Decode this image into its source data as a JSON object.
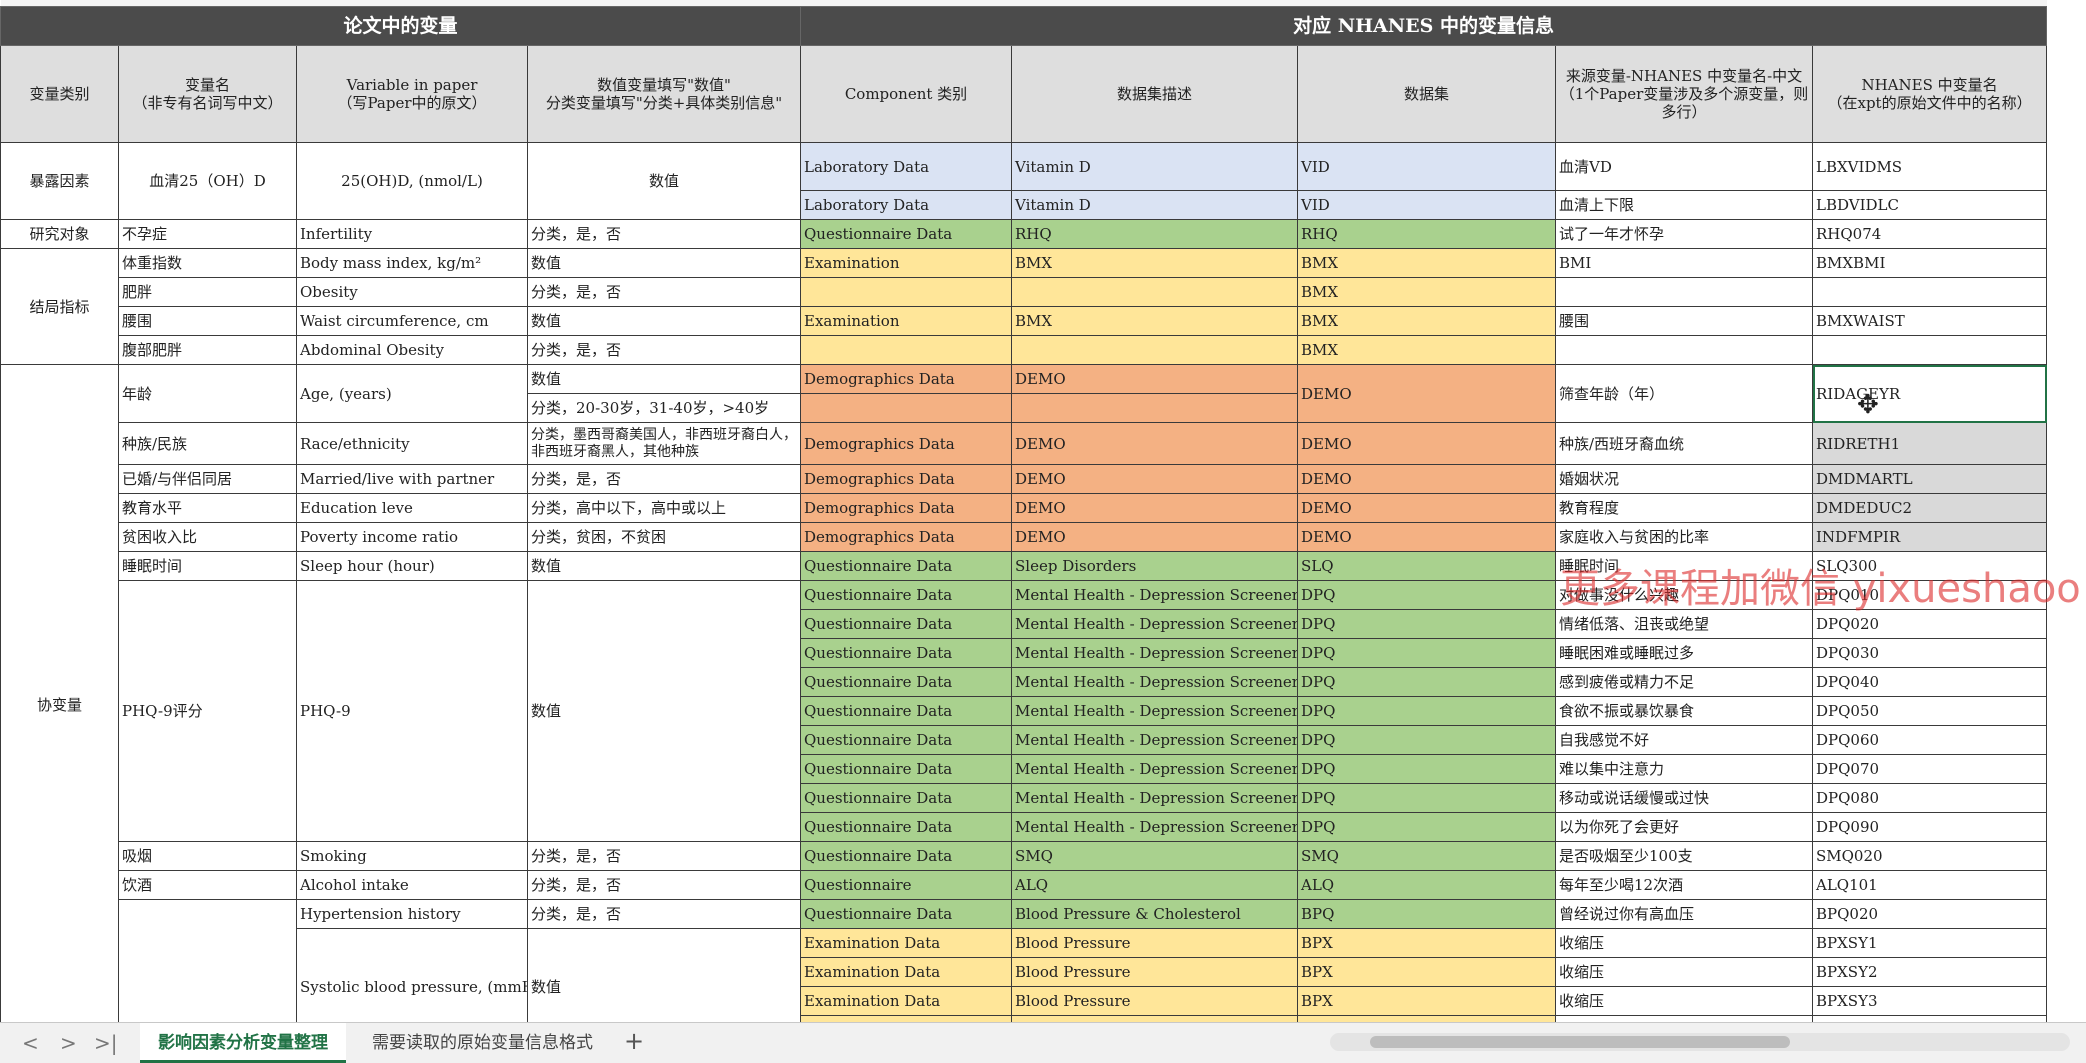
{
  "header": {
    "left": "论文中的变量",
    "right": "对应 NHANES 中的变量信息",
    "cols": [
      "变量类别",
      "变量名\n（非专有名词写中文）",
      "Variable in paper\n（写Paper中的原文）",
      "数值变量填写\"数值\"\n分类变量填写\"分类+具体类别信息\"",
      "Component 类别",
      "数据集描述",
      "数据集",
      "来源变量-NHANES 中变量名-中文\n（1个Paper变量涉及多个源变量，则多行）",
      "NHANES 中变量名\n（在xpt的原始文件中的名称）"
    ]
  },
  "groups": {
    "exposure": "暴露因素",
    "subject": "研究对象",
    "outcome": "结局指标",
    "covariate": "协变量"
  },
  "rows": {
    "r1": {
      "cn": "血清25（OH）D",
      "en": "25(OH)D, (nmol/L)",
      "type": "数值",
      "comp": "Laboratory Data",
      "desc": "Vitamin D",
      "ds": "VID",
      "src": "血清VD",
      "var": "LBXVIDMS"
    },
    "r2": {
      "comp": "Laboratory Data",
      "desc": "Vitamin D",
      "ds": "VID",
      "src": "血清上下限",
      "var": "LBDVIDLC"
    },
    "r3": {
      "cn": "不孕症",
      "en": "Infertility",
      "type": "分类，是，否",
      "comp": "Questionnaire Data",
      "desc": "RHQ",
      "ds": "RHQ",
      "src": "试了一年才怀孕",
      "var": "RHQ074"
    },
    "r4": {
      "cn": "体重指数",
      "en": "Body mass index, kg/m²",
      "type": "数值",
      "comp": "Examination",
      "desc": "BMX",
      "ds": "BMX",
      "src": "BMI",
      "var": "BMXBMI"
    },
    "r5": {
      "cn": "肥胖",
      "en": "Obesity",
      "type": "分类，是，否",
      "ds": "BMX"
    },
    "r6": {
      "cn": "腰围",
      "en": "Waist circumference, cm",
      "type": "数值",
      "comp": "Examination",
      "desc": "BMX",
      "ds": "BMX",
      "src": "腰围",
      "var": "BMXWAIST"
    },
    "r7": {
      "cn": "腹部肥胖",
      "en": "Abdominal Obesity",
      "type": "分类，是，否",
      "ds": "BMX"
    },
    "r8": {
      "cn": "年龄",
      "en": "Age, (years)",
      "type": "数值",
      "type2": "分类，20-30岁，31-40岁，>40岁",
      "comp": "Demographics Data",
      "desc": "DEMO",
      "ds": "DEMO",
      "src": "筛查年龄（年）",
      "var": "RIDAGEYR"
    },
    "r9": {
      "cn": "种族/民族",
      "en": "Race/ethnicity",
      "type": "分类，墨西哥裔美国人，非西班牙裔白人，非西班牙裔黑人，其他种族",
      "comp": "Demographics Data",
      "desc": "DEMO",
      "ds": "DEMO",
      "src": "种族/西班牙裔血统",
      "var": "RIDRETH1"
    },
    "r10": {
      "cn": "已婚/与伴侣同居",
      "en": "Married/live with partner",
      "type": "分类，是，否",
      "comp": "Demographics Data",
      "desc": "DEMO",
      "ds": "DEMO",
      "src": "婚姻状况",
      "var": "DMDMARTL"
    },
    "r11": {
      "cn": "教育水平",
      "en": "Education leve",
      "type": "分类，高中以下，高中或以上",
      "comp": "Demographics Data",
      "desc": "DEMO",
      "ds": "DEMO",
      "src": "教育程度",
      "var": "DMDEDUC2"
    },
    "r12": {
      "cn": "贫困收入比",
      "en": "Poverty income ratio",
      "type": "分类，贫困，不贫困",
      "comp": "Demographics Data",
      "desc": "DEMO",
      "ds": "DEMO",
      "src": "家庭收入与贫困的比率",
      "var": "INDFMPIR"
    },
    "r13": {
      "cn": "睡眠时间",
      "en": "Sleep hour (hour)",
      "type": "数值",
      "comp": "Questionnaire Data",
      "desc": "Sleep Disorders",
      "ds": "SLQ",
      "src": "睡眠时间",
      "var": "SLQ300"
    },
    "phq": {
      "cn": "PHQ-9评分",
      "en": "PHQ-9",
      "type": "数值"
    },
    "p1": {
      "comp": "Questionnaire Data",
      "desc": "Mental Health - Depression Screener",
      "ds": "DPQ",
      "src": "对做事没什么兴趣",
      "var": "DPQ010"
    },
    "p2": {
      "comp": "Questionnaire Data",
      "desc": "Mental Health - Depression Screener",
      "ds": "DPQ",
      "src": "情绪低落、沮丧或绝望",
      "var": "DPQ020"
    },
    "p3": {
      "comp": "Questionnaire Data",
      "desc": "Mental Health - Depression Screener",
      "ds": "DPQ",
      "src": "睡眠困难或睡眠过多",
      "var": "DPQ030"
    },
    "p4": {
      "comp": "Questionnaire Data",
      "desc": "Mental Health - Depression Screener",
      "ds": "DPQ",
      "src": "感到疲倦或精力不足",
      "var": "DPQ040"
    },
    "p5": {
      "comp": "Questionnaire Data",
      "desc": "Mental Health - Depression Screener",
      "ds": "DPQ",
      "src": "食欲不振或暴饮暴食",
      "var": "DPQ050"
    },
    "p6": {
      "comp": "Questionnaire Data",
      "desc": "Mental Health - Depression Screener",
      "ds": "DPQ",
      "src": "自我感觉不好",
      "var": "DPQ060"
    },
    "p7": {
      "comp": "Questionnaire Data",
      "desc": "Mental Health - Depression Screener",
      "ds": "DPQ",
      "src": "难以集中注意力",
      "var": "DPQ070"
    },
    "p8": {
      "comp": "Questionnaire Data",
      "desc": "Mental Health - Depression Screener",
      "ds": "DPQ",
      "src": "移动或说话缓慢或过快",
      "var": "DPQ080"
    },
    "p9": {
      "comp": "Questionnaire Data",
      "desc": "Mental Health - Depression Screener",
      "ds": "DPQ",
      "src": "以为你死了会更好",
      "var": "DPQ090"
    },
    "r14": {
      "cn": "吸烟",
      "en": "Smoking",
      "type": "分类，是，否",
      "comp": "Questionnaire Data",
      "desc": "SMQ",
      "ds": "SMQ",
      "src": "是否吸烟至少100支",
      "var": "SMQ020"
    },
    "r15": {
      "cn": "饮酒",
      "en": "Alcohol intake",
      "type": "分类，是，否",
      "comp": "Questionnaire",
      "desc": "ALQ",
      "ds": "ALQ",
      "src": "每年至少喝12次酒",
      "var": "ALQ101"
    },
    "r16": {
      "en": "Hypertension history",
      "type": "分类，是，否",
      "comp": "Questionnaire Data",
      "desc": "Blood Pressure & Cholesterol",
      "ds": "BPQ",
      "src": "曾经说过你有高血压",
      "var": "BPQ020"
    },
    "sbp": {
      "en": "Systolic blood pressure, (mmHg)",
      "type": "数值"
    },
    "b1": {
      "comp": "Examination Data",
      "desc": "Blood Pressure",
      "ds": "BPX",
      "src": "收缩压",
      "var": "BPXSY1"
    },
    "b2": {
      "comp": "Examination Data",
      "desc": "Blood Pressure",
      "ds": "BPX",
      "src": "收缩压",
      "var": "BPXSY2"
    },
    "b3": {
      "comp": "Examination Data",
      "desc": "Blood Pressure",
      "ds": "BPX",
      "src": "收缩压",
      "var": "BPXSY3"
    }
  },
  "watermark": "更多课程加微信 yixueshaoo",
  "tabs": {
    "active": "影响因素分析变量整理",
    "second": "需要读取的原始变量信息格式",
    "add": "+"
  },
  "nav": {
    "first": "<",
    "prev": ">",
    "last": ">|"
  }
}
